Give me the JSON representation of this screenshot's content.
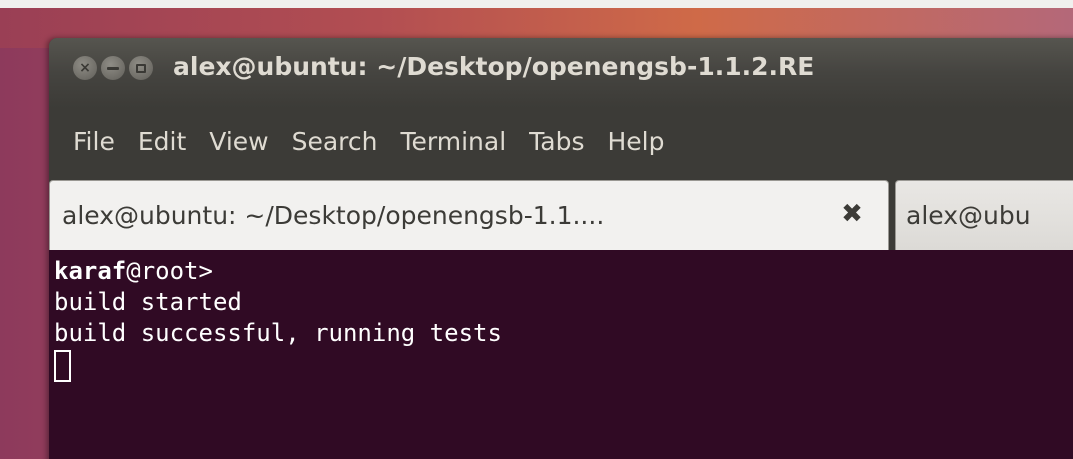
{
  "window": {
    "title": "alex@ubuntu: ~/Desktop/openengsb-1.1.2.RE"
  },
  "menu": {
    "items": [
      "File",
      "Edit",
      "View",
      "Search",
      "Terminal",
      "Tabs",
      "Help"
    ]
  },
  "tabs": [
    {
      "label": "alex@ubuntu: ~/Desktop/openengsb-1.1....",
      "active": true,
      "close_icon": "close-x-icon"
    },
    {
      "label": "alex@ubu",
      "active": false
    }
  ],
  "terminal": {
    "prompt_user": "karaf",
    "prompt_rest": "@root>",
    "lines": [
      "build started",
      "build successful, running tests"
    ],
    "background": "#300a24",
    "foreground": "#ffffff"
  },
  "colors": {
    "titlebar": "#3c3b37",
    "desktop_accent": "#c9624e"
  }
}
